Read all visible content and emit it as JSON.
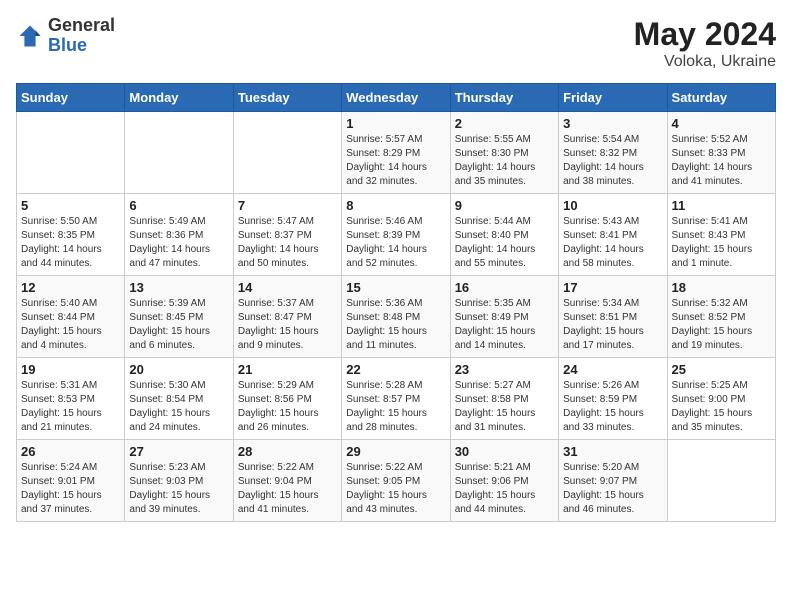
{
  "header": {
    "logo_general": "General",
    "logo_blue": "Blue",
    "title": "May 2024",
    "location": "Voloka, Ukraine"
  },
  "days_of_week": [
    "Sunday",
    "Monday",
    "Tuesday",
    "Wednesday",
    "Thursday",
    "Friday",
    "Saturday"
  ],
  "weeks": [
    [
      {
        "day": "",
        "info": ""
      },
      {
        "day": "",
        "info": ""
      },
      {
        "day": "",
        "info": ""
      },
      {
        "day": "1",
        "info": "Sunrise: 5:57 AM\nSunset: 8:29 PM\nDaylight: 14 hours\nand 32 minutes."
      },
      {
        "day": "2",
        "info": "Sunrise: 5:55 AM\nSunset: 8:30 PM\nDaylight: 14 hours\nand 35 minutes."
      },
      {
        "day": "3",
        "info": "Sunrise: 5:54 AM\nSunset: 8:32 PM\nDaylight: 14 hours\nand 38 minutes."
      },
      {
        "day": "4",
        "info": "Sunrise: 5:52 AM\nSunset: 8:33 PM\nDaylight: 14 hours\nand 41 minutes."
      }
    ],
    [
      {
        "day": "5",
        "info": "Sunrise: 5:50 AM\nSunset: 8:35 PM\nDaylight: 14 hours\nand 44 minutes."
      },
      {
        "day": "6",
        "info": "Sunrise: 5:49 AM\nSunset: 8:36 PM\nDaylight: 14 hours\nand 47 minutes."
      },
      {
        "day": "7",
        "info": "Sunrise: 5:47 AM\nSunset: 8:37 PM\nDaylight: 14 hours\nand 50 minutes."
      },
      {
        "day": "8",
        "info": "Sunrise: 5:46 AM\nSunset: 8:39 PM\nDaylight: 14 hours\nand 52 minutes."
      },
      {
        "day": "9",
        "info": "Sunrise: 5:44 AM\nSunset: 8:40 PM\nDaylight: 14 hours\nand 55 minutes."
      },
      {
        "day": "10",
        "info": "Sunrise: 5:43 AM\nSunset: 8:41 PM\nDaylight: 14 hours\nand 58 minutes."
      },
      {
        "day": "11",
        "info": "Sunrise: 5:41 AM\nSunset: 8:43 PM\nDaylight: 15 hours\nand 1 minute."
      }
    ],
    [
      {
        "day": "12",
        "info": "Sunrise: 5:40 AM\nSunset: 8:44 PM\nDaylight: 15 hours\nand 4 minutes."
      },
      {
        "day": "13",
        "info": "Sunrise: 5:39 AM\nSunset: 8:45 PM\nDaylight: 15 hours\nand 6 minutes."
      },
      {
        "day": "14",
        "info": "Sunrise: 5:37 AM\nSunset: 8:47 PM\nDaylight: 15 hours\nand 9 minutes."
      },
      {
        "day": "15",
        "info": "Sunrise: 5:36 AM\nSunset: 8:48 PM\nDaylight: 15 hours\nand 11 minutes."
      },
      {
        "day": "16",
        "info": "Sunrise: 5:35 AM\nSunset: 8:49 PM\nDaylight: 15 hours\nand 14 minutes."
      },
      {
        "day": "17",
        "info": "Sunrise: 5:34 AM\nSunset: 8:51 PM\nDaylight: 15 hours\nand 17 minutes."
      },
      {
        "day": "18",
        "info": "Sunrise: 5:32 AM\nSunset: 8:52 PM\nDaylight: 15 hours\nand 19 minutes."
      }
    ],
    [
      {
        "day": "19",
        "info": "Sunrise: 5:31 AM\nSunset: 8:53 PM\nDaylight: 15 hours\nand 21 minutes."
      },
      {
        "day": "20",
        "info": "Sunrise: 5:30 AM\nSunset: 8:54 PM\nDaylight: 15 hours\nand 24 minutes."
      },
      {
        "day": "21",
        "info": "Sunrise: 5:29 AM\nSunset: 8:56 PM\nDaylight: 15 hours\nand 26 minutes."
      },
      {
        "day": "22",
        "info": "Sunrise: 5:28 AM\nSunset: 8:57 PM\nDaylight: 15 hours\nand 28 minutes."
      },
      {
        "day": "23",
        "info": "Sunrise: 5:27 AM\nSunset: 8:58 PM\nDaylight: 15 hours\nand 31 minutes."
      },
      {
        "day": "24",
        "info": "Sunrise: 5:26 AM\nSunset: 8:59 PM\nDaylight: 15 hours\nand 33 minutes."
      },
      {
        "day": "25",
        "info": "Sunrise: 5:25 AM\nSunset: 9:00 PM\nDaylight: 15 hours\nand 35 minutes."
      }
    ],
    [
      {
        "day": "26",
        "info": "Sunrise: 5:24 AM\nSunset: 9:01 PM\nDaylight: 15 hours\nand 37 minutes."
      },
      {
        "day": "27",
        "info": "Sunrise: 5:23 AM\nSunset: 9:03 PM\nDaylight: 15 hours\nand 39 minutes."
      },
      {
        "day": "28",
        "info": "Sunrise: 5:22 AM\nSunset: 9:04 PM\nDaylight: 15 hours\nand 41 minutes."
      },
      {
        "day": "29",
        "info": "Sunrise: 5:22 AM\nSunset: 9:05 PM\nDaylight: 15 hours\nand 43 minutes."
      },
      {
        "day": "30",
        "info": "Sunrise: 5:21 AM\nSunset: 9:06 PM\nDaylight: 15 hours\nand 44 minutes."
      },
      {
        "day": "31",
        "info": "Sunrise: 5:20 AM\nSunset: 9:07 PM\nDaylight: 15 hours\nand 46 minutes."
      },
      {
        "day": "",
        "info": ""
      }
    ]
  ]
}
